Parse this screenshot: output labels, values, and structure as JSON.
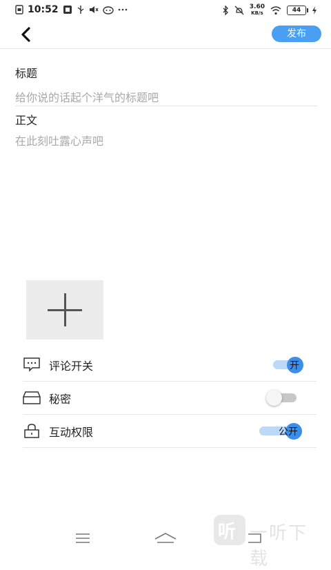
{
  "status_bar": {
    "time": "10:52",
    "net_speed_value": "3.60",
    "net_speed_unit": "KB/s",
    "battery_level": "44",
    "left_icons": [
      "sim-icon",
      "app-badge-icon",
      "usb-icon",
      "volume-muted-icon",
      "cat-app-icon",
      "more-dots-icon"
    ],
    "right_icons": [
      "bluetooth-icon",
      "mute-icon",
      "wifi-icon",
      "battery-icon",
      "charging-icon"
    ]
  },
  "header": {
    "back_icon": "chevron-left-icon",
    "publish_label": "发布",
    "accent_color": "#4a9ff2"
  },
  "editor": {
    "title_label": "标题",
    "title_placeholder": "给你说的话起个洋气的标题吧",
    "body_label": "正文",
    "body_placeholder": "在此刻吐露心声吧"
  },
  "media": {
    "add_icon": "plus-icon"
  },
  "settings": [
    {
      "icon": "comment-icon",
      "label": "评论开关",
      "toggle_state": "on",
      "toggle_text": "开"
    },
    {
      "icon": "drawer-icon",
      "label": "秘密",
      "toggle_state": "off",
      "toggle_text": ""
    },
    {
      "icon": "lock-icon",
      "label": "互动权限",
      "toggle_state": "on",
      "toggle_text": "公开"
    }
  ],
  "bottom_nav": {
    "icons": [
      "menu-icon",
      "home-icon",
      "back-nav-icon"
    ]
  },
  "watermark": {
    "logo_text": "听",
    "text": "一听下载"
  }
}
